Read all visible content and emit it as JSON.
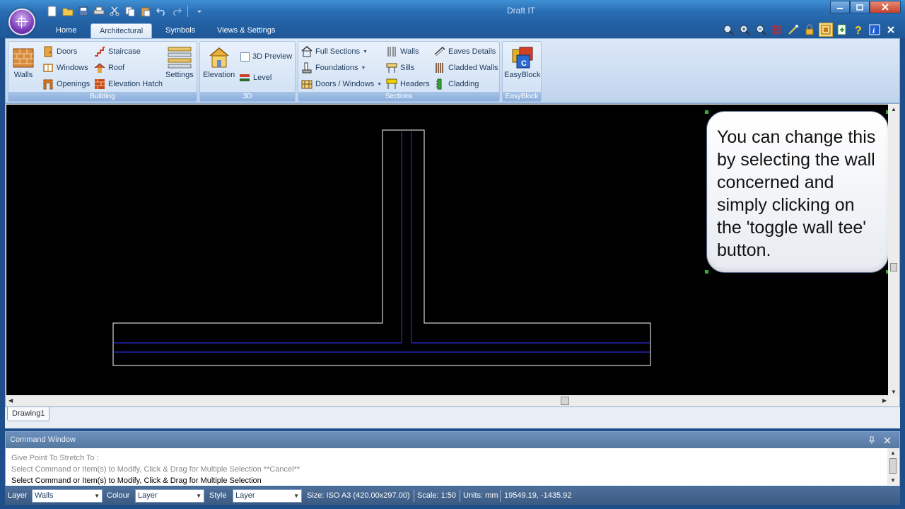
{
  "window": {
    "title": "Draft IT"
  },
  "tabs": [
    {
      "label": "Home",
      "active": false
    },
    {
      "label": "Architectural",
      "active": true
    },
    {
      "label": "Symbols",
      "active": false
    },
    {
      "label": "Views & Settings",
      "active": false
    }
  ],
  "ribbon": {
    "building": {
      "group_label": "Building",
      "walls": "Walls",
      "doors": "Doors",
      "windows": "Windows",
      "openings": "Openings",
      "staircase": "Staircase",
      "roof": "Roof",
      "elevation_hatch": "Elevation Hatch",
      "settings": "Settings"
    },
    "threed": {
      "group_label": "3D",
      "elevation": "Elevation",
      "preview_3d": "3D Preview",
      "level": "Level"
    },
    "sections": {
      "group_label": "Sections",
      "full_sections": "Full Sections",
      "foundations": "Foundations",
      "doors_windows": "Doors / Windows",
      "walls": "Walls",
      "sills": "Sills",
      "headers": "Headers",
      "eaves_details": "Eaves Details",
      "cladded_walls": "Cladded Walls",
      "cladding": "Cladding"
    },
    "easyblock": {
      "group_label": "EasyBlock",
      "button": "EasyBlock"
    }
  },
  "callout": {
    "text": "You can change this by selecting the wall concerned and simply clicking on the 'toggle wall tee' button."
  },
  "document_tab": "Drawing1",
  "command_window": {
    "title": "Command Window",
    "lines": [
      "Give Point To Stretch To :",
      "Select Command or Item(s) to Modify, Click & Drag for Multiple Selection  **Cancel**",
      "Select Command or Item(s) to Modify, Click & Drag for Multiple Selection"
    ]
  },
  "status_bar": {
    "layer_label": "Layer",
    "layer_value": "Walls",
    "colour_label": "Colour",
    "colour_value": "Layer",
    "style_label": "Style",
    "style_value": "Layer",
    "size": "Size: ISO A3 (420.00x297.00)",
    "scale": "Scale: 1:50",
    "units": "Units: mm",
    "coords": "19549.19, -1435.92"
  },
  "colors": {
    "wall_outline": "#ffffff",
    "wall_centerline": "#2b2bd9",
    "canvas_background": "#000000"
  }
}
